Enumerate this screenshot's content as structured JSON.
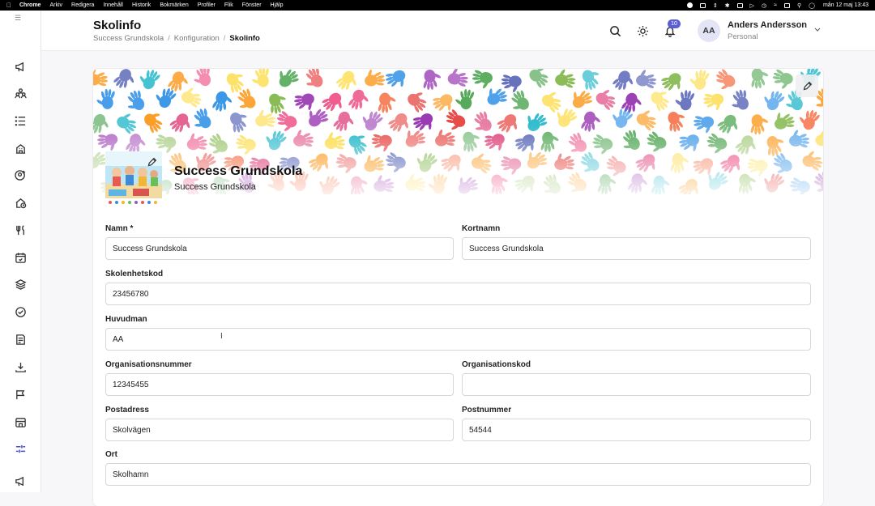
{
  "menubar": {
    "app": "Chrome",
    "items": [
      "Arkiv",
      "Redigera",
      "Innehåll",
      "Historik",
      "Bokmärken",
      "Profiler",
      "Flik",
      "Fönster",
      "Hjälp"
    ],
    "clock": "mån 12 maj 13:43"
  },
  "header": {
    "title": "Skolinfo",
    "breadcrumb": [
      "Success Grundskola",
      "Konfiguration",
      "Skolinfo"
    ],
    "notification_count": "10",
    "user": {
      "initials": "AA",
      "name": "Anders Andersson",
      "role": "Personal"
    }
  },
  "school": {
    "name": "Success Grundskola",
    "subtitle": "Success Grundskola"
  },
  "form": {
    "namn": {
      "label": "Namn *",
      "value": "Success Grundskola"
    },
    "kortnamn": {
      "label": "Kortnamn",
      "value": "Success Grundskola"
    },
    "skolenhetskod": {
      "label": "Skolenhetskod",
      "value": "23456780"
    },
    "huvudman": {
      "label": "Huvudman",
      "value": "AA"
    },
    "organisationsnummer": {
      "label": "Organisationsnummer",
      "value": "12345455"
    },
    "organisationskod": {
      "label": "Organisationskod",
      "value": ""
    },
    "postadress": {
      "label": "Postadress",
      "value": "Skolvägen"
    },
    "postnummer": {
      "label": "Postnummer",
      "value": "54544"
    },
    "ort": {
      "label": "Ort",
      "value": "Skolhamn"
    }
  },
  "colors": {
    "accent": "#5a5fd6",
    "sidebar_active": "#4b4fc4"
  },
  "icons": {
    "sidebar": [
      "menu-icon",
      "megaphone-icon",
      "users-icon",
      "list-icon",
      "building-icon",
      "user-plus-icon",
      "home-clock-icon",
      "utensils-icon",
      "calendar-icon",
      "layers-icon",
      "check-circle-icon",
      "document-icon",
      "download-icon",
      "flag-icon",
      "store-icon",
      "sliders-icon",
      "megaphone-icon"
    ],
    "header": [
      "search-icon",
      "sun-icon",
      "bell-icon",
      "chevron-down-icon"
    ]
  }
}
